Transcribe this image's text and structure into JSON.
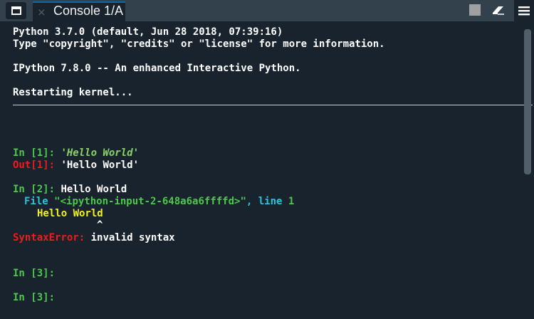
{
  "tab": {
    "title": "Console 1/A",
    "close_glyph": "×"
  },
  "banner": {
    "line1": "Python 3.7.0 (default, Jun 28 2018, 07:39:16)",
    "line2": "Type \"copyright\", \"credits\" or \"license\" for more information.",
    "line3": "IPython 7.8.0 -- An enhanced Interactive Python.",
    "line4": "Restarting kernel..."
  },
  "cells": {
    "in1_prompt": "In [",
    "in1_num": "1",
    "in1_close": "]: ",
    "in1_code": "'Hello World'",
    "out1_prompt": "Out[",
    "out1_num": "1",
    "out1_close": "]: ",
    "out1_value": "'Hello World'",
    "in2_prompt": "In [",
    "in2_num": "2",
    "in2_close": "]: ",
    "in2_code": "Hello World",
    "tb_file_label": "File ",
    "tb_file": "\"<ipython-input-2-648a6a6ffffd>\"",
    "tb_line_label": ", line ",
    "tb_line": "1",
    "tb_code": "Hello World",
    "tb_caret": "^",
    "err_name": "SyntaxError:",
    "err_msg": " invalid syntax",
    "in3a_prompt": "In [",
    "in3a_num": "3",
    "in3a_close": "]:",
    "in3b_prompt": "In [",
    "in3b_num": "3",
    "in3b_close": "]:"
  },
  "icons": {
    "window": "window-icon",
    "close": "close-icon",
    "stop": "stop-icon",
    "eraser": "eraser-icon",
    "menu": "menu-icon"
  },
  "colors": {
    "background": "#19232d",
    "tabbar": "#32414b",
    "accent": "#1464a0",
    "prompt_in": "#4dc84d",
    "prompt_out": "#ef1c1c",
    "string": "#8ad16a",
    "traceback_file": "#26c6da",
    "traceback_code": "#f2f21a"
  }
}
